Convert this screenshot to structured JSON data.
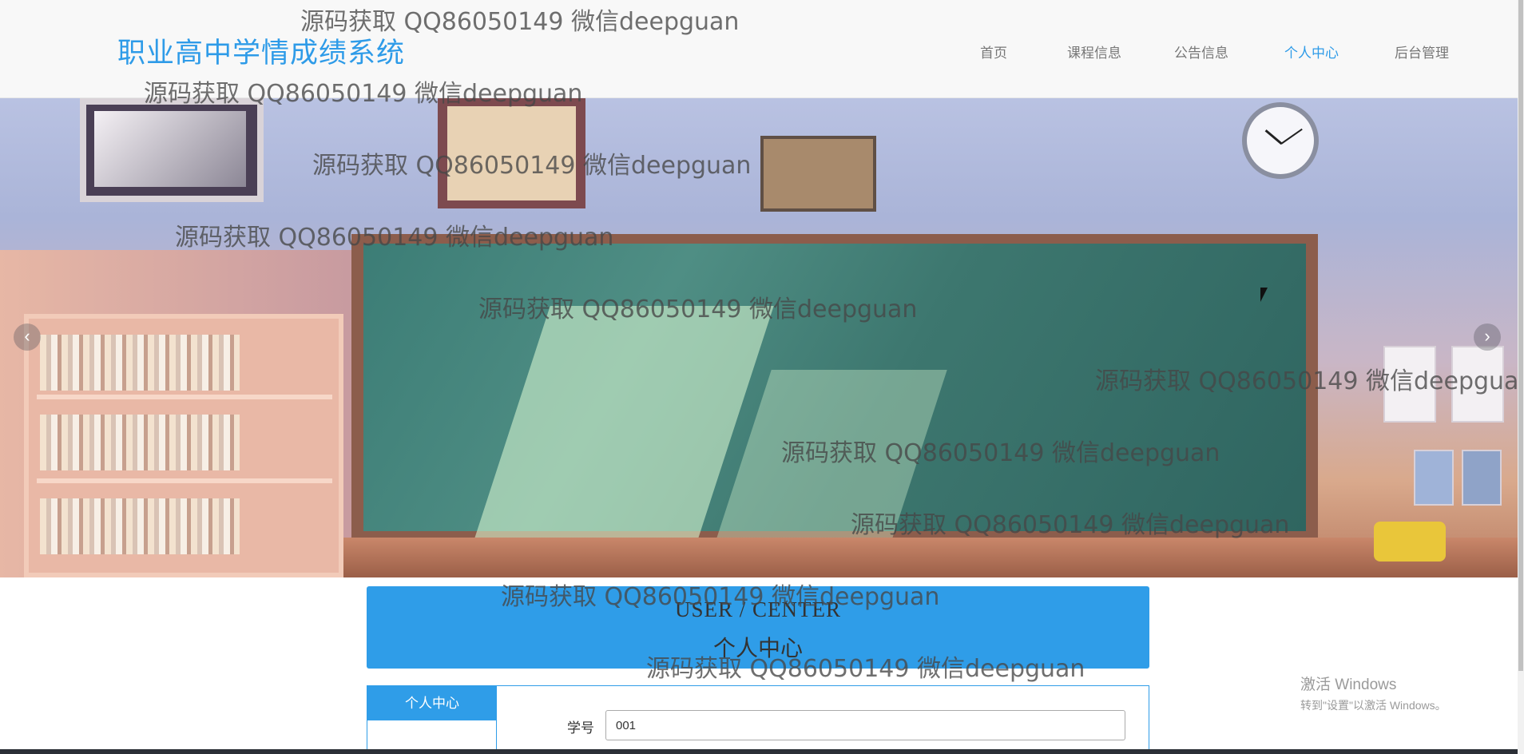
{
  "header": {
    "site_title": "职业高中学情成绩系统",
    "nav": [
      {
        "label": "首页",
        "active": false
      },
      {
        "label": "课程信息",
        "active": false
      },
      {
        "label": "公告信息",
        "active": false
      },
      {
        "label": "个人中心",
        "active": true
      },
      {
        "label": "后台管理",
        "active": false
      }
    ]
  },
  "banner": {
    "prev_icon": "chevron-left-icon",
    "next_icon": "chevron-right-icon",
    "prev_glyph": "‹",
    "next_glyph": "›"
  },
  "watermark": "源码获取 QQ86050149 微信deepguan",
  "center": {
    "title_en": "USER / CENTER",
    "title_cn": "个人中心"
  },
  "sidebar": {
    "heading": "个人中心"
  },
  "form": {
    "student_id_label": "学号",
    "student_id_value": "001"
  },
  "windows_activation": {
    "line1": "激活 Windows",
    "line2": "转到\"设置\"以激活 Windows。"
  },
  "colors": {
    "accent": "#2f9de8",
    "nav_text": "#777777",
    "header_bg": "#f8f8f8"
  }
}
